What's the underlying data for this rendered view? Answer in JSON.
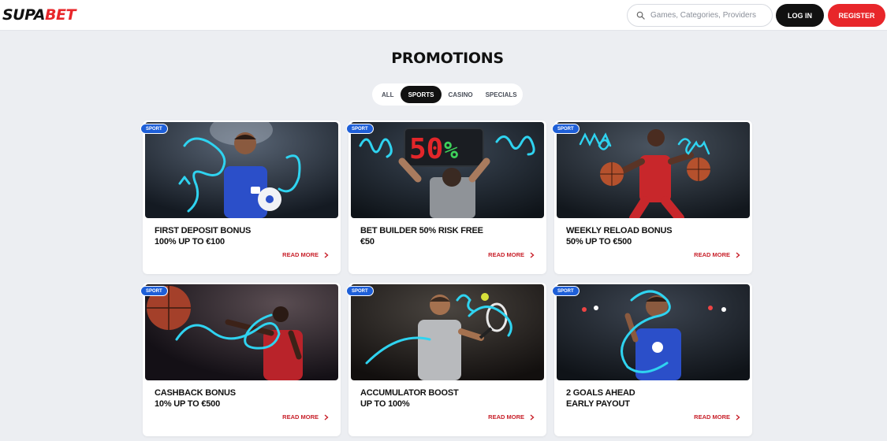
{
  "header": {
    "logo_part1": "SUPA",
    "logo_part2": "BET",
    "search_placeholder": "Games, Categories, Providers",
    "login_label": "LOG IN",
    "register_label": "REGISTER"
  },
  "page": {
    "title": "PROMOTIONS"
  },
  "tabs": [
    {
      "label": "ALL",
      "active": false
    },
    {
      "label": "SPORTS",
      "active": true
    },
    {
      "label": "CASINO",
      "active": false
    },
    {
      "label": "SPECIALS",
      "active": false
    }
  ],
  "promotions": [
    {
      "badge": "SPORT",
      "line1": "FIRST DEPOSIT BONUS",
      "line2": "100% UP TO €100",
      "cta": "READ MORE"
    },
    {
      "badge": "SPORT",
      "line1": "BET BUILDER 50% RISK FREE",
      "line2": "€50",
      "cta": "READ MORE"
    },
    {
      "badge": "SPORT",
      "line1": "WEEKLY RELOAD BONUS",
      "line2": "50% UP TO €500",
      "cta": "READ MORE"
    },
    {
      "badge": "SPORT",
      "line1": "CASHBACK BONUS",
      "line2": "10% UP TO €500",
      "cta": "READ MORE"
    },
    {
      "badge": "SPORT",
      "line1": "ACCUMULATOR BOOST",
      "line2": "UP TO 100%",
      "cta": "READ MORE"
    },
    {
      "badge": "SPORT",
      "line1": "2 GOALS AHEAD",
      "line2": "EARLY PAYOUT",
      "cta": "READ MORE"
    }
  ],
  "colors": {
    "brand_red": "#e8262a",
    "badge_blue": "#1e5fd8",
    "neon_cyan": "#2fd3f0",
    "background": "#eceef2"
  }
}
